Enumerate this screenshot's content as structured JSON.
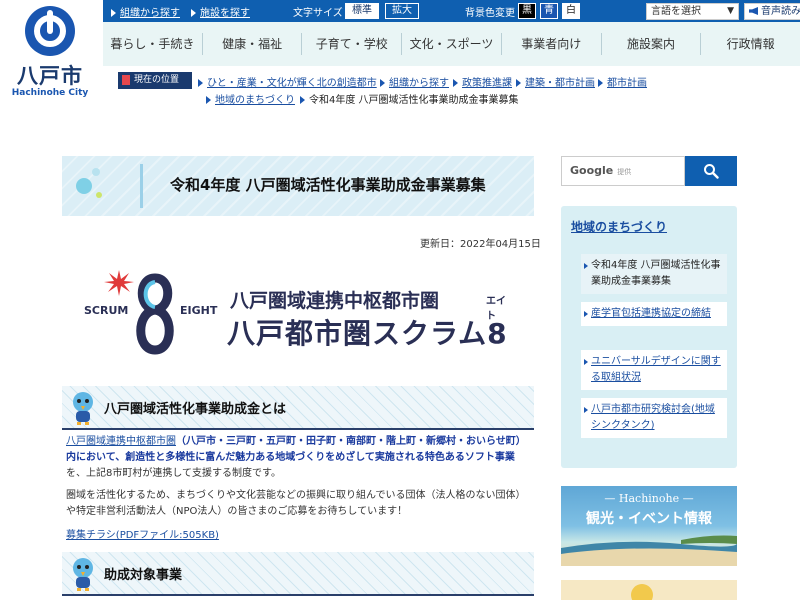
{
  "logo": {
    "name": "八戸市",
    "sub": "Hachinohe City"
  },
  "topbar": {
    "link_org": "組織から探す",
    "link_facility": "施設を探す",
    "font_size_label": "文字サイズ",
    "font_standard": "標準",
    "font_large": "拡大",
    "bg_label": "背景色変更",
    "bg_black": "黒",
    "bg_blue": "青",
    "bg_white": "白",
    "lang_select": "言語を選択",
    "read_aloud": "音声読み上げ"
  },
  "nav": [
    "暮らし・手続き",
    "健康・福祉",
    "子育て・学校",
    "文化・スポーツ",
    "事業者向け",
    "施設案内",
    "行政情報"
  ],
  "breadcrumb": {
    "badge": "現在の位置",
    "items": [
      "ひと・産業・文化が輝く北の創造都市",
      "組織から探す",
      "政策推進課",
      "建築・都市計画",
      "都市計画",
      "地域のまちづくり"
    ],
    "current": "令和4年度 八戸圏域活性化事業助成金事業募集"
  },
  "page": {
    "title": "令和4年度 八戸圏域活性化事業助成金事業募集",
    "updated": "更新日：2022年04月15日"
  },
  "scrum": {
    "scrum": "SCRUM",
    "eight": "EIGHT",
    "line1": "八戸圏域連携中枢都市圏",
    "line2": "八戸都市圏スクラム8",
    "eito": "エイト"
  },
  "section1": {
    "title": "八戸圏域活性化事業助成金とは",
    "p1_link": "八戸圏域連携中枢都市圏",
    "p1_hl": "（八戸市・三戸町・五戸町・田子町・南部町・階上町・新郷村・おいらせ町）内において、創造性と多様性に富んだ魅力ある地域づくりをめざして実施される特色あるソフト事業",
    "p1_rest": "を、上記8市町村が連携して支援する制度です。",
    "p2": "圏域を活性化するため、まちづくりや文化芸能などの振興に取り組んでいる団体（法人格のない団体）や特定非営利活動法人（NPO法人）の皆さまのご応募をお待ちしています！",
    "pdf": "募集チラシ(PDFファイル:505KB)"
  },
  "section2": {
    "title": "助成対象事業"
  },
  "search": {
    "brand": "Google",
    "placeholder": "提供"
  },
  "side": {
    "title": "地域のまちづくり",
    "items": [
      "令和4年度 八戸圏域活性化事業助成金事業募集",
      "産学官包括連携協定の締結",
      "ユニバーサルデザインに関する取組状況",
      "八戸市都市研究検討会(地域シンクタンク)"
    ]
  },
  "promo": {
    "en": "— Hachinohe —",
    "jp": "観光・イベント情報"
  },
  "colors": {
    "primary": "#0f5fb0",
    "navy": "#1a3a6e",
    "nav_bg": "#e9f5f5",
    "side_bg": "#d9eff4"
  }
}
